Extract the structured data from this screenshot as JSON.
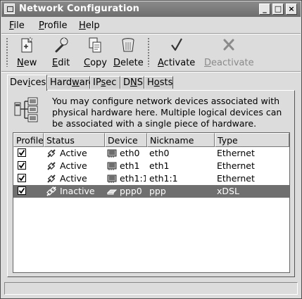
{
  "window": {
    "title": "Network Configuration",
    "buttons": {
      "minimize": "_",
      "maximize": "□",
      "close": "×"
    }
  },
  "menu": [
    {
      "accel": "F",
      "rest": "ile"
    },
    {
      "accel": "P",
      "rest": "rofile"
    },
    {
      "accel": "H",
      "rest": "elp"
    }
  ],
  "toolbar": {
    "new": {
      "accel": "N",
      "rest": "ew",
      "icon": "new-document-icon"
    },
    "edit": {
      "accel": "E",
      "rest": "dit",
      "icon": "wrench-icon"
    },
    "copy": {
      "accel": "C",
      "rest": "opy",
      "icon": "copy-icon"
    },
    "delete": {
      "accel": "D",
      "rest": "elete",
      "icon": "trash-icon"
    },
    "activate": {
      "accel": "A",
      "rest": "ctivate",
      "icon": "checkmark-icon"
    },
    "deactivate": {
      "accel": "D",
      "rest": "eactivate",
      "icon": "x-icon",
      "disabled": true
    }
  },
  "tabs": [
    {
      "pre": "Dev",
      "accel": "i",
      "post": "ces",
      "active": true
    },
    {
      "pre": "Hard",
      "accel": "w",
      "post": "are"
    },
    {
      "pre": "IP",
      "accel": "s",
      "post": "ec"
    },
    {
      "pre": "D",
      "accel": "N",
      "post": "S"
    },
    {
      "pre": "H",
      "accel": "o",
      "post": "sts"
    }
  ],
  "devices_tab": {
    "info_text": "You may configure network devices associated with physical hardware here.  Multiple logical devices can be associated with a single piece of hardware.",
    "columns": [
      "Profile",
      "Status",
      "Device",
      "Nickname",
      "Type"
    ],
    "rows": [
      {
        "profile": true,
        "status": "Active",
        "device": "eth0",
        "nickname": "eth0",
        "type": "Ethernet"
      },
      {
        "profile": true,
        "status": "Active",
        "device": "eth1",
        "nickname": "eth1",
        "type": "Ethernet"
      },
      {
        "profile": true,
        "status": "Active",
        "device": "eth1:1",
        "nickname": "eth1:1",
        "type": "Ethernet"
      },
      {
        "profile": true,
        "status": "Inactive",
        "device": "ppp0",
        "nickname": "ppp",
        "type": "xDSL",
        "selected": true
      }
    ]
  },
  "colors": {
    "selection": "#6f6f6f",
    "titlebar": "#7a7a7a",
    "window_bg": "#dcdcdc"
  }
}
